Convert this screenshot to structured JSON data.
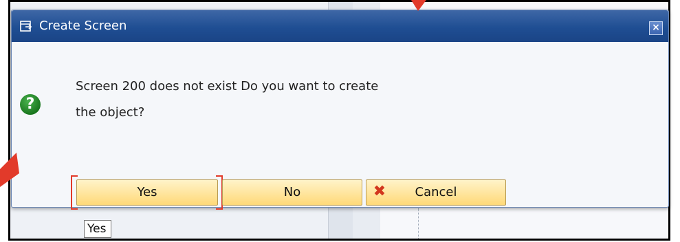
{
  "dialog": {
    "title": "Create Screen",
    "close_symbol": "×",
    "message_line1": "Screen 200 does not exist Do you want to create",
    "message_line2": "the object?",
    "icon": "question-icon"
  },
  "buttons": {
    "yes": "Yes",
    "no": "No",
    "cancel": "Cancel"
  },
  "tooltip": "Yes",
  "colors": {
    "titlebar": "#1f4e93",
    "button_fill": "#ffd978",
    "question_icon": "#16731b",
    "annotation": "#e23a2a"
  }
}
